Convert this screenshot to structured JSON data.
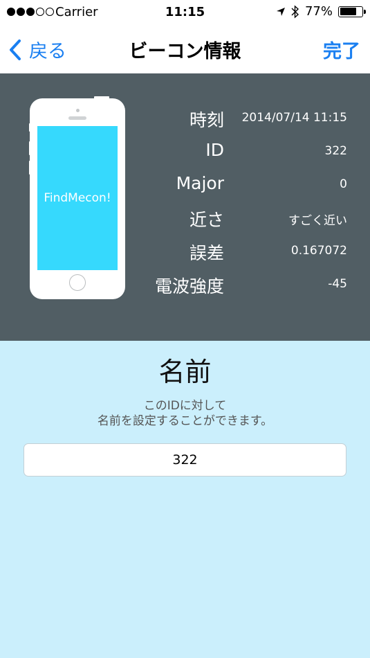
{
  "status_bar": {
    "carrier": "Carrier",
    "time": "11:15",
    "battery_percent": "77%",
    "battery_level": 0.77,
    "signal_bars_filled": 3,
    "signal_bars_total": 5
  },
  "nav": {
    "back_label": "戻る",
    "title": "ビーコン情報",
    "done_label": "完了",
    "accent_color": "#1a7ff1"
  },
  "phone": {
    "screen_text": "FindMecon!",
    "screen_color": "#36d9fd"
  },
  "info": {
    "rows": [
      {
        "label": "時刻",
        "value": "2014/07/14 11:15"
      },
      {
        "label": "ID",
        "value": "322"
      },
      {
        "label": "Major",
        "value": "0"
      },
      {
        "label": "近さ",
        "value": "すごく近い"
      },
      {
        "label": "誤差",
        "value": "0.167072"
      },
      {
        "label": "電波強度",
        "value": "-45"
      }
    ],
    "panel_color": "#515e64"
  },
  "name_section": {
    "title": "名前",
    "description_line1": "このIDに対して",
    "description_line2": "名前を設定することができます。",
    "input_value": "322",
    "background_color": "#cbeffc"
  }
}
